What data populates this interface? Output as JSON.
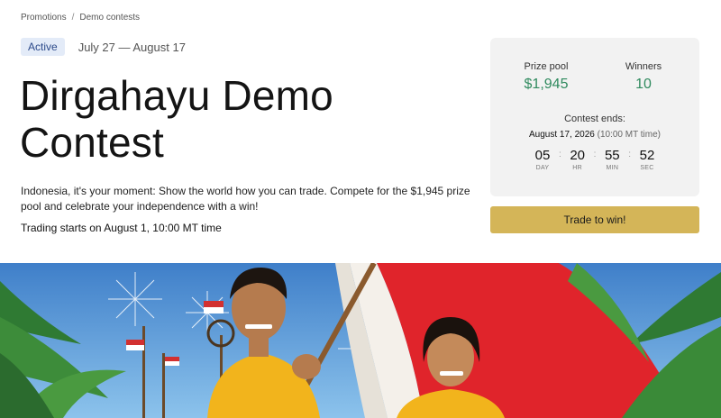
{
  "breadcrumb": {
    "items": [
      "Promotions",
      "Demo contests"
    ],
    "separator": "/"
  },
  "contest": {
    "status": "Active",
    "dates": "July 27 — August 17",
    "title": "Dirgahayu Demo Contest",
    "description": "Indonesia, it's your moment: Show the world how you can trade. Compete for the $1,945 prize pool and celebrate your independence with a win!",
    "trading_start": "Trading starts on August 1, 10:00 MT time"
  },
  "card": {
    "prize_pool_label": "Prize pool",
    "prize_pool_value": "$1,945",
    "winners_label": "Winners",
    "winners_value": "10",
    "ends_label": "Contest ends:",
    "ends_date": "August 17, 2026",
    "ends_tz": "(10:00 MT time)",
    "countdown": [
      {
        "value": "05",
        "unit": "DAY"
      },
      {
        "value": "20",
        "unit": "HR"
      },
      {
        "value": "55",
        "unit": "MIN"
      },
      {
        "value": "52",
        "unit": "SEC"
      }
    ]
  },
  "cta": {
    "label": "Trade to win!"
  },
  "colors": {
    "accent_gold": "#d4b558",
    "value_green": "#2f8a5e",
    "badge_bg": "#e3ebf8"
  },
  "hero": {
    "image": "hero-banner-illustration"
  }
}
